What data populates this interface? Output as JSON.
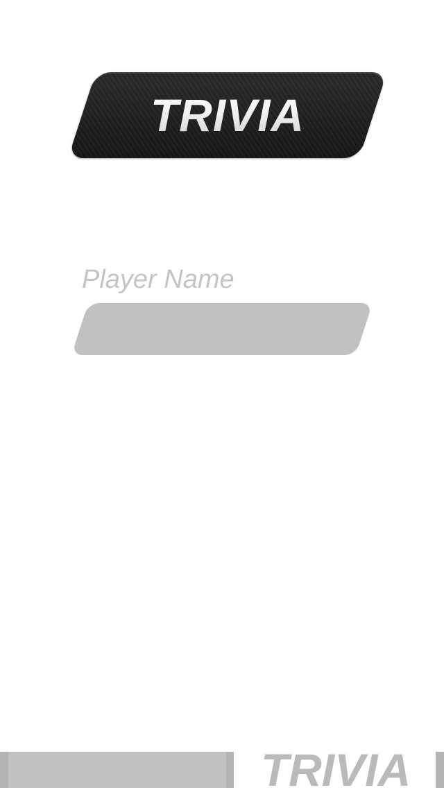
{
  "logo": {
    "text": "TRIVIA"
  },
  "player": {
    "label": "Player Name",
    "value": ""
  },
  "footer": {
    "wordmark": "TRIVIA"
  },
  "colors": {
    "background": "#ffffff",
    "logo_badge": "#1f1f1f",
    "input_fill": "#c1c1c1",
    "label_text": "#c4c4c4",
    "footer_gray": "#b4b4b4"
  }
}
